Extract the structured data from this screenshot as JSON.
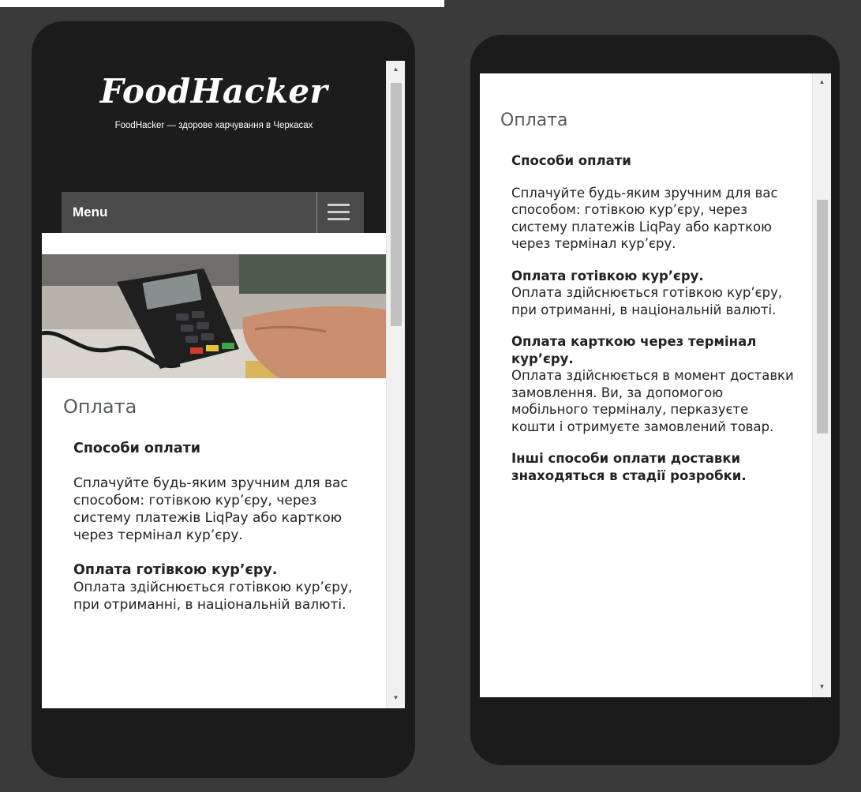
{
  "left_screen": {
    "site_title": "FoodHacker",
    "tagline": "FoodHacker — здорове харчування в Черкасах",
    "menu_label": "Menu",
    "page_title": "Оплата",
    "section_heading": "Способи оплати",
    "intro_text": "Сплачуйте будь-яким зручним для вас способом: готівкою кур’єру, через систему платежів LiqPay або карткою через термінал кур’єру.",
    "cash_heading": "Оплата готівкою кур’єру.",
    "cash_text": "Оплата здійснюється готівкою кур’єру, при отриманні, в національній валюті."
  },
  "right_screen": {
    "page_title": "Оплата",
    "section_heading": "Способи оплати",
    "intro_text": "Сплачуйте будь-яким зручним для вас способом: готівкою кур’єру, через систему платежів LiqPay або карткою через термінал кур’єру.",
    "cash_heading": "Оплата готівкою кур’єру.",
    "cash_text": "Оплата здійснюється готівкою кур’єру, при отриманні, в національній валюті.",
    "card_heading": "Оплата карткою через термінал кур’єру.",
    "card_text": "Оплата здійснюється в момент доставки замовлення. Ви, за допомогою мобільного терміналу, перказуєте кошти і отримуєте замовлений товар.",
    "other_methods": "Інші способи оплати доставки знаходяться в стадії розробки."
  },
  "icons": {
    "menu": "hamburger-icon",
    "scroll_up": "triangle-up-icon",
    "scroll_down": "triangle-down-icon"
  },
  "colors": {
    "background": "#3a3a3a",
    "phone_frame": "#1b1b1b",
    "header": "#1c1c1c",
    "menu_bar": "#4b4b4b",
    "heading_text": "#555a60"
  }
}
